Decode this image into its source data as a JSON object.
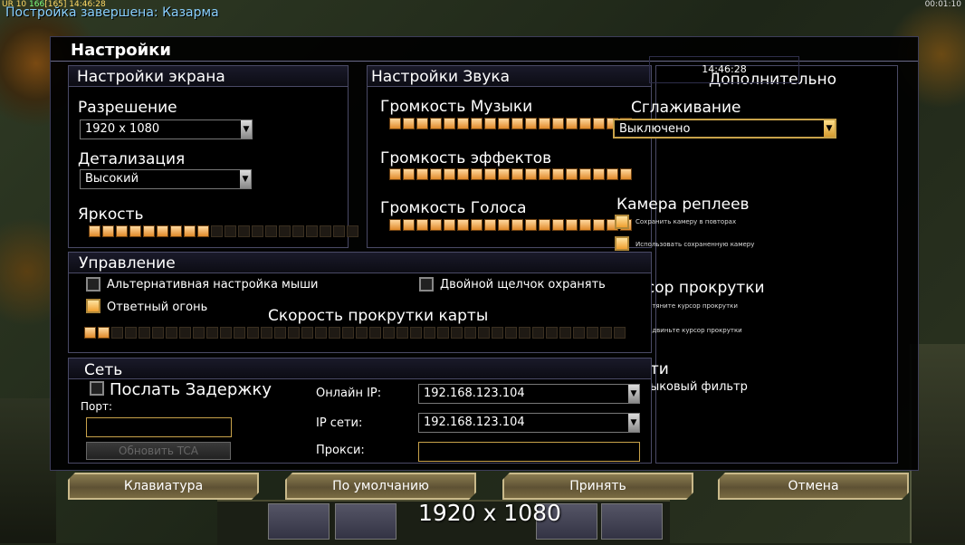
{
  "top_bar": {
    "status_left": "UR 10",
    "status_num": "166",
    "status_num2": "[165]",
    "clock": "14:46:28",
    "message": "Постройка завершена: Казарма",
    "timer": "00:01:10"
  },
  "window": {
    "title": "Настройки"
  },
  "screen": {
    "title": "Настройки экрана",
    "resolution_label": "Разрешение",
    "resolution_value": "1920 x 1080",
    "detail_label": "Детализация",
    "detail_value": "Высокий",
    "brightness_label": "Яркость",
    "brightness_level": 0.45
  },
  "sound": {
    "title": "Настройки Звука",
    "music_label": "Громкость Музыки",
    "music_level": 1.0,
    "effects_label": "Громкость эффектов",
    "effects_level": 1.0,
    "voice_label": "Громкость Голоса",
    "voice_level": 1.0
  },
  "extra": {
    "title": "Дополнительно",
    "time": "14:46:28",
    "aa_label": "Сглаживание",
    "aa_value": "Выключено",
    "replay_camera_title": "Камера реплеев",
    "replay_opt1": "Сохранить камеру в повторах",
    "replay_opt2": "Использовать сохраненную камеру",
    "scroll_cursor_title": "Курсор прокрутки",
    "scroll_opt1": "Перетяните курсор прокрутки",
    "scroll_opt2": "Передвиньте курсор прокрутки",
    "online_title": "В сети",
    "lang_filter": "Языковый фильтр"
  },
  "control": {
    "title": "Управление",
    "alt_mouse": "Альтернативная настройка мыши",
    "double_click": "Двойной щелчок охранять",
    "return_fire": "Ответный огонь",
    "scroll_speed_label": "Скорость прокрутки карты",
    "scroll_speed_level": 0.06
  },
  "network": {
    "title": "Сеть",
    "send_delay": "Послать Задержку",
    "port_label": "Порт:",
    "update_tca": "Обновить TCA",
    "online_ip_label": "Онлайн IP:",
    "online_ip": "192.168.123.104",
    "lan_ip_label": "IP сети:",
    "lan_ip": "192.168.123.104",
    "proxy_label": "Прокси:"
  },
  "buttons": {
    "keyboard": "Клавиатура",
    "defaults": "По умолчанию",
    "accept": "Принять",
    "cancel": "Отмена"
  },
  "overlay_resolution": "1920 x 1080",
  "icons": [
    "dropdown-arrow-icon"
  ]
}
